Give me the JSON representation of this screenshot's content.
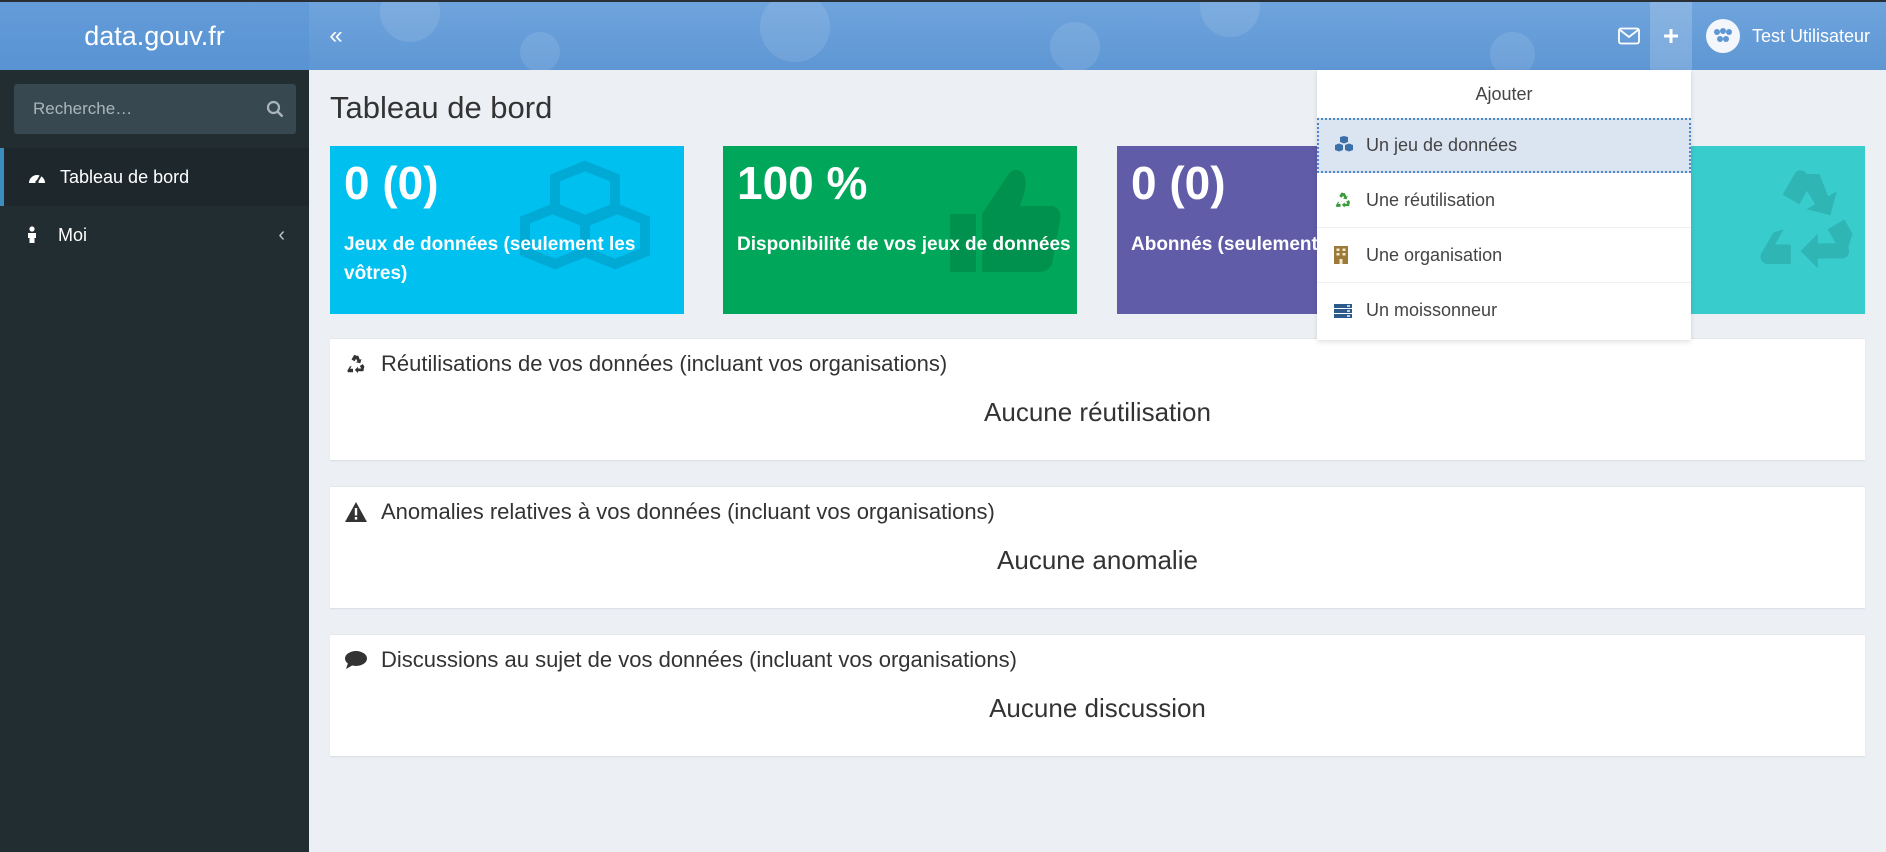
{
  "header": {
    "logo": "data.gouv.fr",
    "collapse_label": "«",
    "user_name": "Test Utilisateur"
  },
  "sidebar": {
    "search_placeholder": "Recherche…",
    "items": [
      {
        "label": "Tableau de bord",
        "icon": "dashboard-icon",
        "active": true
      },
      {
        "label": "Moi",
        "icon": "user-icon",
        "chevron": "‹"
      }
    ]
  },
  "main": {
    "title": "Tableau de bord",
    "tiles": [
      {
        "value": "0 (0)",
        "label": "Jeux de données (seulement les vôtres)",
        "color": "#00c0ef",
        "icon": "cubes-icon"
      },
      {
        "value": "100 %",
        "label": "Disponibilité de vos jeux de données",
        "color": "#00a65a",
        "icon": "thumbs-up-icon"
      },
      {
        "value": "0 (0)",
        "label": "Abonnés (seulement le",
        "color": "#605ca8",
        "icon": "users-icon"
      },
      {
        "value": "",
        "label": "",
        "color": "#39cccc",
        "icon": "recycle-icon"
      }
    ],
    "boxes": [
      {
        "title": "Réutilisations de vos données (incluant vos organisations)",
        "empty": "Aucune réutilisation",
        "icon": "recycle-icon"
      },
      {
        "title": "Anomalies relatives à vos données (incluant vos organisations)",
        "empty": "Aucune anomalie",
        "icon": "warning-icon"
      },
      {
        "title": "Discussions au sujet de vos données (incluant vos organisations)",
        "empty": "Aucune discussion",
        "icon": "comment-icon"
      }
    ]
  },
  "dropdown": {
    "header": "Ajouter",
    "items": [
      {
        "label": "Un jeu de données",
        "icon": "cubes-icon",
        "color": "#3c6fa8"
      },
      {
        "label": "Une réutilisation",
        "icon": "recycle-icon",
        "color": "#3a9a3a"
      },
      {
        "label": "Une organisation",
        "icon": "building-icon",
        "color": "#9c7a3c"
      },
      {
        "label": "Un moissonneur",
        "icon": "server-icon",
        "color": "#2c5a8a"
      }
    ]
  }
}
